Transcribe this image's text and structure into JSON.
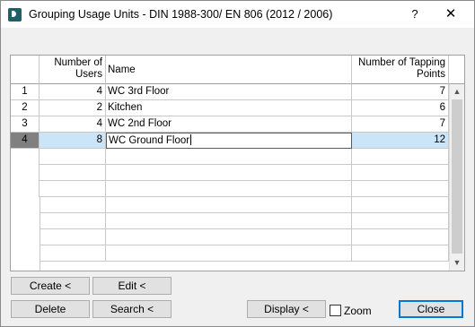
{
  "window": {
    "title": "Grouping Usage Units - DIN 1988-300/ EN 806 (2012 / 2006)",
    "help_label": "?",
    "close_label": "✕"
  },
  "grid": {
    "columns": {
      "users": "Number of Users",
      "name": "Name",
      "tapping": "Number of Tapping Points"
    },
    "rows": [
      {
        "index": "1",
        "users": "4",
        "name": "WC 3rd Floor",
        "tapping": "7"
      },
      {
        "index": "2",
        "users": "2",
        "name": "Kitchen",
        "tapping": "6"
      },
      {
        "index": "3",
        "users": "4",
        "name": "WC 2nd Floor",
        "tapping": "7"
      },
      {
        "index": "4",
        "users": "8",
        "name": "WC Ground Floor",
        "tapping": "12"
      }
    ],
    "selected_row": 4,
    "scroll_up": "▲",
    "scroll_down": "▼"
  },
  "buttons": {
    "create": "Create <",
    "edit": "Edit <",
    "delete": "Delete",
    "search": "Search <",
    "display": "Display <",
    "zoom": "Zoom",
    "close": "Close"
  },
  "zoom_checked": false,
  "colors": {
    "selection": "#cce4f7",
    "row_header_selected": "#808080",
    "default_button_border": "#0078d7",
    "app_icon": "#1f5f66"
  }
}
